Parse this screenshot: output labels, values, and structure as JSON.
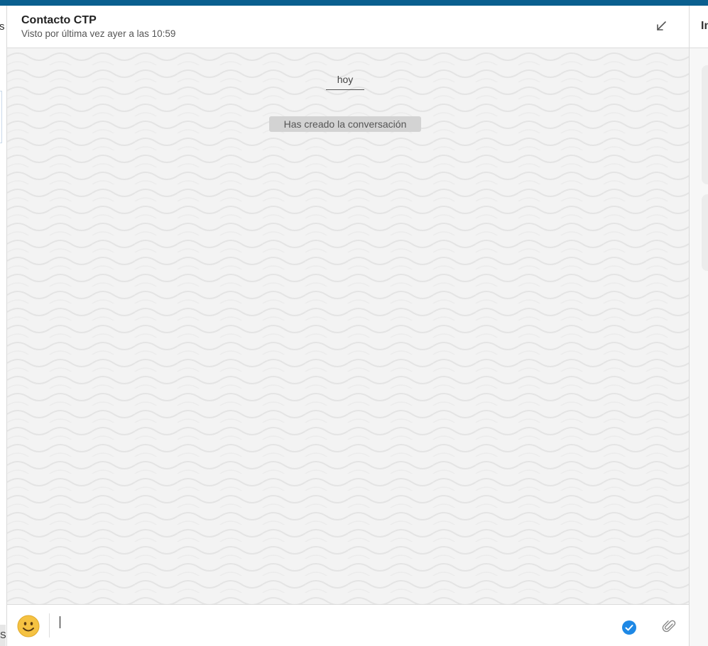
{
  "left_edge": {
    "fragment_text": "s",
    "bottom_fragment": "S"
  },
  "chat": {
    "contact_name": "Contacto CTP",
    "last_seen": "Visto por última vez ayer a las 10:59",
    "date_separator": "hoy",
    "system_message": "Has creado la conversación"
  },
  "composer": {
    "input_value": "",
    "input_placeholder": ""
  },
  "right_panel": {
    "title_fragment": "In"
  },
  "icons": {
    "minimize": "minimize-arrow-icon",
    "emoji": "smiley-emoji-icon",
    "send": "check-circle-icon",
    "attach": "paperclip-icon"
  },
  "colors": {
    "topbar": "#0a5f8f",
    "check_blue": "#1e88e5",
    "emoji_yellow": "#f5c242"
  }
}
